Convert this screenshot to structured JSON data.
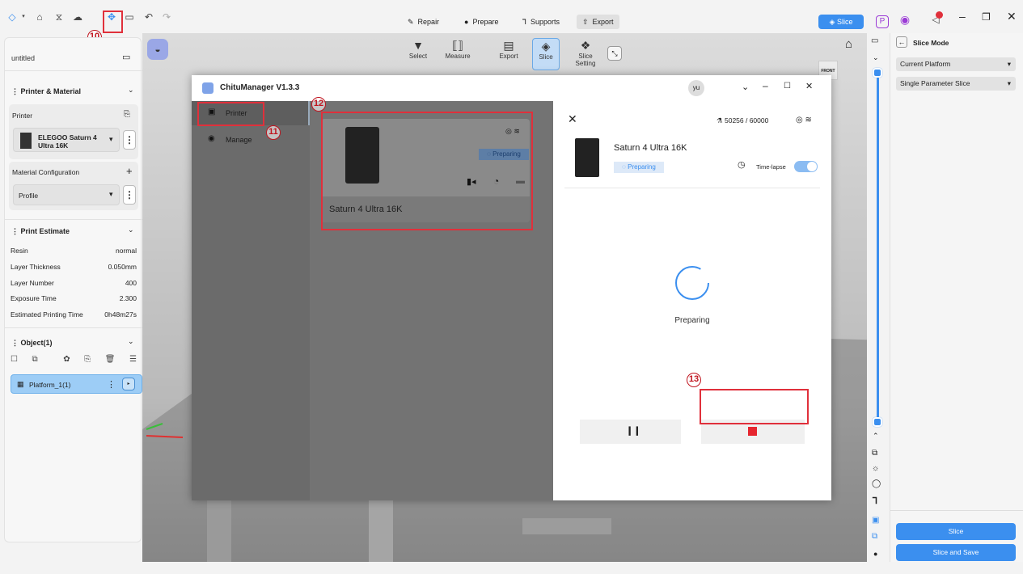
{
  "topbar": {
    "mode_tabs": [
      {
        "label": "Repair",
        "icon": "wrench-icon"
      },
      {
        "label": "Prepare",
        "icon": "brush-icon"
      },
      {
        "label": "Supports",
        "icon": "support-icon"
      },
      {
        "label": "Export",
        "icon": "export-icon"
      }
    ],
    "slice_label": "Slice",
    "callout_10": "10"
  },
  "sidebar": {
    "title": "untitled",
    "printer_material_header": "Printer & Material",
    "printer_label": "Printer",
    "printer_name": "ELEGOO Saturn 4 Ultra 16K",
    "material_config_label": "Material Configuration",
    "profile_label": "Profile",
    "print_estimate_header": "Print Estimate",
    "estimates": [
      {
        "label": "Resin",
        "value": "normal"
      },
      {
        "label": "Layer Thickness",
        "value": "0.050mm"
      },
      {
        "label": "Layer Number",
        "value": "400"
      },
      {
        "label": "Exposure Time",
        "value": "2.300"
      },
      {
        "label": "Estimated Printing Time",
        "value": "0h48m27s"
      }
    ],
    "object_header": "Object(1)",
    "platform_item": "Platform_1(1)"
  },
  "viewport_toolbar": [
    {
      "label": "Select",
      "icon": "cursor-icon"
    },
    {
      "label": "Measure",
      "icon": "measure-icon"
    },
    {
      "label": "Export",
      "icon": "export-file-icon"
    },
    {
      "label": "Slice",
      "icon": "layers-icon"
    },
    {
      "label": "Slice Setting",
      "icon": "slice-setting-icon"
    }
  ],
  "viewcube_label": "FRONT",
  "modal": {
    "title": "ChituManager V1.3.3",
    "user_avatar": "yu",
    "nav_printer": "Printer",
    "nav_manage": "Manage",
    "callout_11": "11",
    "callout_12": "12",
    "callout_13": "13",
    "card_status": "Preparing",
    "card_printer_name": "Saturn 4 Ultra 16K",
    "detail": {
      "counter": "50256 / 60000",
      "printer_name": "Saturn 4 Ultra 16K",
      "status_badge": "Preparing",
      "timelapse_label": "Time-lapse",
      "progress_status": "Preparing"
    }
  },
  "right_panel": {
    "title": "Slice Mode",
    "platform_select": "Current Platform",
    "parameter_select": "Single Parameter Slice",
    "slice_button": "Slice",
    "slice_save_button": "Slice and Save"
  },
  "colors": {
    "accent": "#3b8fef",
    "highlight": "#e0303b",
    "stop_red": "#e6262f"
  }
}
